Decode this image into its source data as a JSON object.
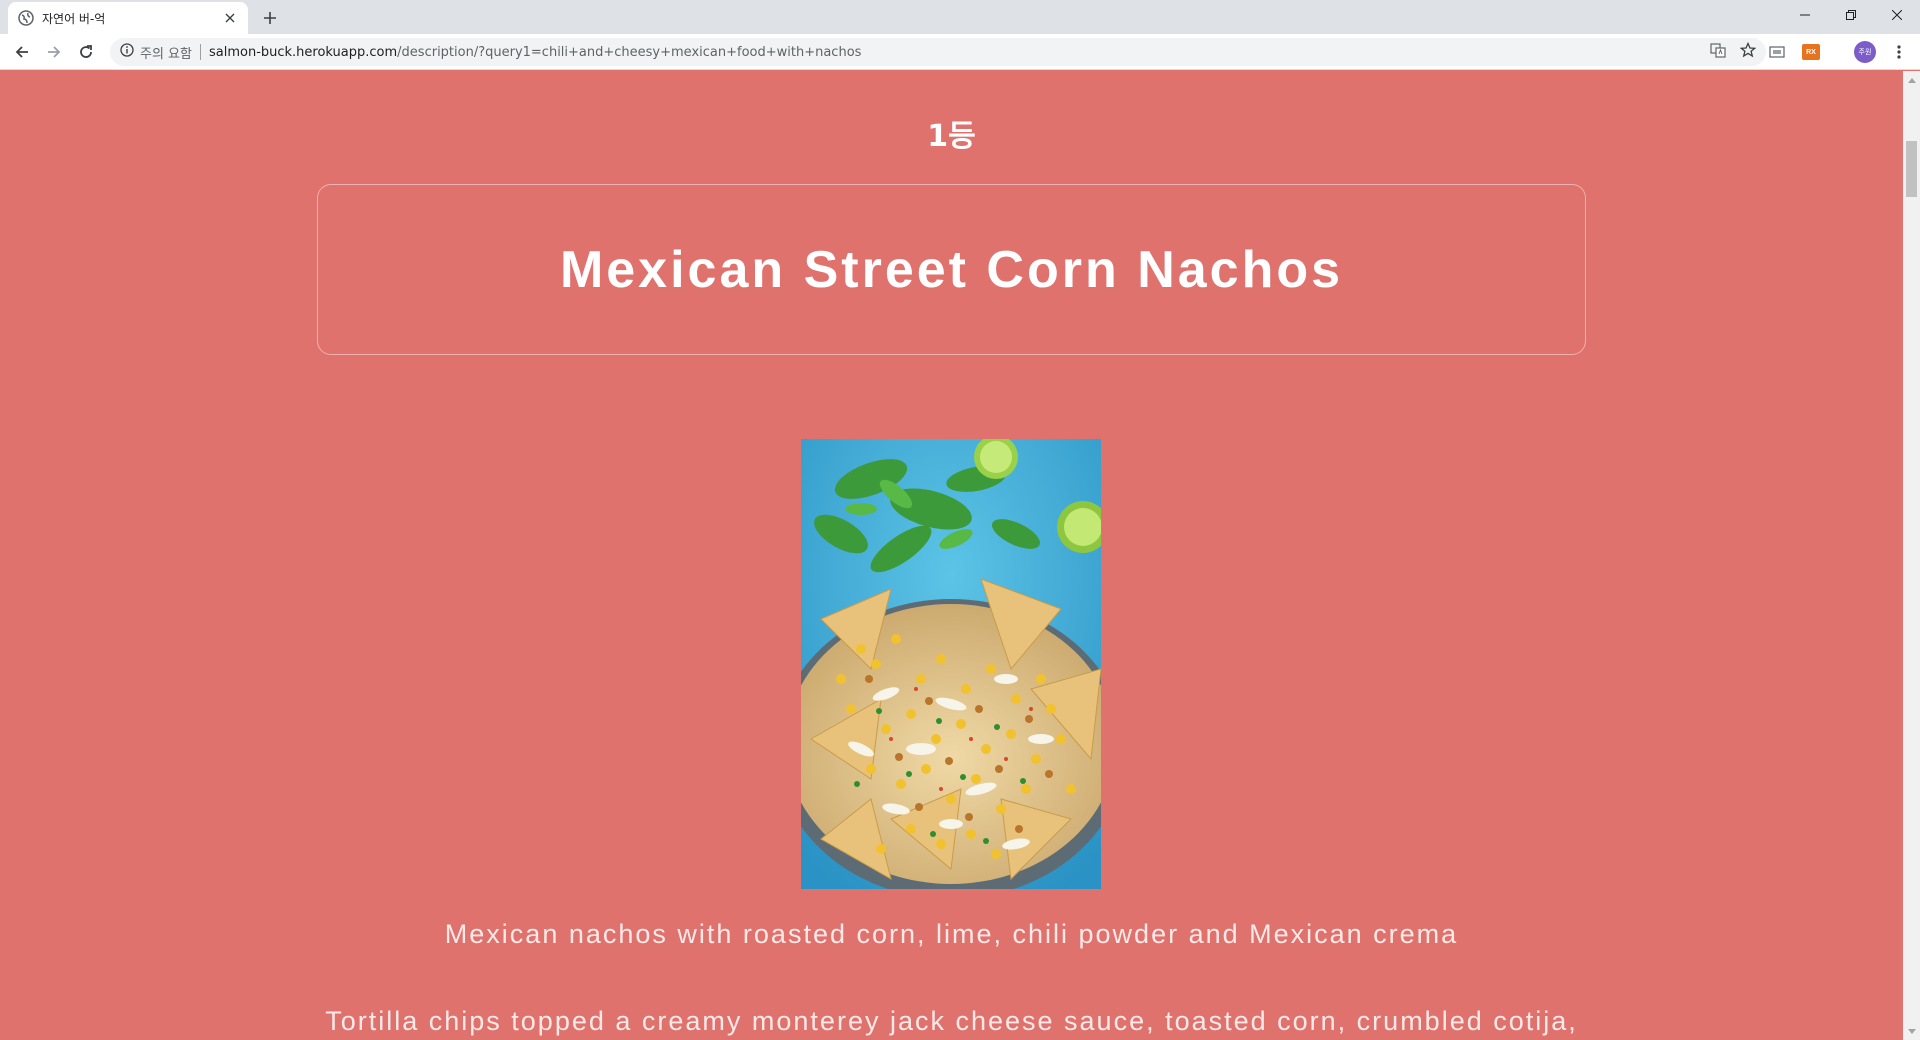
{
  "browser": {
    "tab_title": "자연어 버-억",
    "security_label": "주의 요함",
    "url_host": "salmon-buck.herokuapp.com",
    "url_path": "/description/?query1=chili+and+cheesy+mexican+food+with+nachos",
    "ext_label": "RX",
    "avatar_initials": "주원",
    "icons": [
      "globe-icon",
      "close-icon",
      "plus-icon",
      "minimize-icon",
      "restore-icon",
      "window-close-icon",
      "back-icon",
      "forward-icon",
      "reload-icon",
      "info-icon",
      "translate-icon",
      "star-icon",
      "cast-icon",
      "menu-icon"
    ]
  },
  "page": {
    "rank_label": "1등",
    "recipe_title": "Mexican Street Corn Nachos",
    "subtitle": "Mexican nachos with roasted corn, lime, chili powder and Mexican crema",
    "description": "Tortilla chips topped a creamy monterey jack cheese sauce, toasted corn, crumbled cotija,",
    "background_color": "#e0726e",
    "text_color": "#ffffff"
  }
}
